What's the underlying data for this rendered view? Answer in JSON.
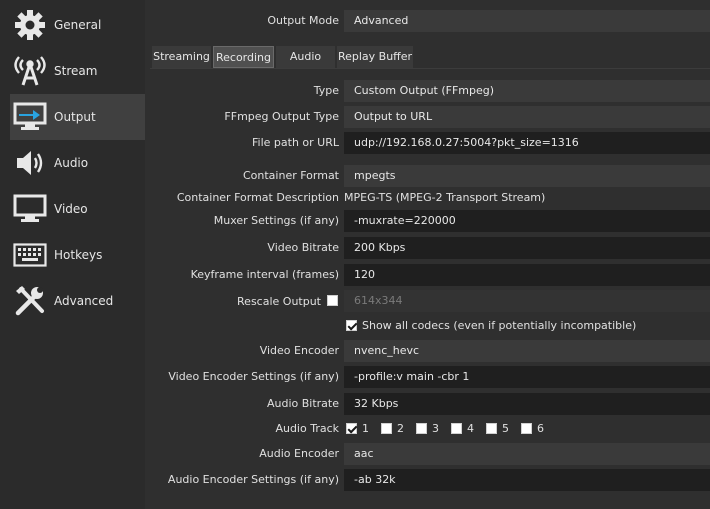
{
  "sidebar": {
    "items": [
      {
        "label": "General",
        "icon": "gear-icon"
      },
      {
        "label": "Stream",
        "icon": "broadcast-antenna-icon"
      },
      {
        "label": "Output",
        "icon": "monitor-output-icon"
      },
      {
        "label": "Audio",
        "icon": "speaker-icon"
      },
      {
        "label": "Video",
        "icon": "monitor-icon"
      },
      {
        "label": "Hotkeys",
        "icon": "keyboard-icon"
      },
      {
        "label": "Advanced",
        "icon": "tools-icon"
      }
    ],
    "active": "Output"
  },
  "output_mode": {
    "label": "Output Mode",
    "value": "Advanced"
  },
  "tabs": [
    {
      "label": "Streaming"
    },
    {
      "label": "Recording"
    },
    {
      "label": "Audio"
    },
    {
      "label": "Replay Buffer"
    }
  ],
  "active_tab": "Recording",
  "form": {
    "type": {
      "label": "Type",
      "value": "Custom Output (FFmpeg)"
    },
    "ffmpeg_output_type": {
      "label": "FFmpeg Output Type",
      "value": "Output to URL"
    },
    "file_path": {
      "label": "File path or URL",
      "value": "udp://192.168.0.27:5004?pkt_size=1316"
    },
    "container_format": {
      "label": "Container Format",
      "value": "mpegts"
    },
    "container_description": {
      "label": "Container Format Description",
      "value": "MPEG-TS (MPEG-2 Transport Stream)"
    },
    "muxer_settings": {
      "label": "Muxer Settings (if any)",
      "value": "-muxrate=220000"
    },
    "video_bitrate": {
      "label": "Video Bitrate",
      "value": "200 Kbps"
    },
    "keyframe_interval": {
      "label": "Keyframe interval (frames)",
      "value": "120"
    },
    "rescale_output": {
      "label": "Rescale Output",
      "checked": false,
      "value": "614x344"
    },
    "show_all_codecs": {
      "label": "Show all codecs (even if potentially incompatible)",
      "checked": true
    },
    "video_encoder": {
      "label": "Video Encoder",
      "value": "nvenc_hevc"
    },
    "video_encoder_settings": {
      "label": "Video Encoder Settings (if any)",
      "value": "-profile:v main -cbr 1"
    },
    "audio_bitrate": {
      "label": "Audio Bitrate",
      "value": "32 Kbps"
    },
    "audio_track": {
      "label": "Audio Track",
      "tracks": [
        {
          "label": "1",
          "checked": true
        },
        {
          "label": "2",
          "checked": false
        },
        {
          "label": "3",
          "checked": false
        },
        {
          "label": "4",
          "checked": false
        },
        {
          "label": "5",
          "checked": false
        },
        {
          "label": "6",
          "checked": false
        }
      ]
    },
    "audio_encoder": {
      "label": "Audio Encoder",
      "value": "aac"
    },
    "audio_encoder_settings": {
      "label": "Audio Encoder Settings (if any)",
      "value": "-ab 32k"
    }
  }
}
